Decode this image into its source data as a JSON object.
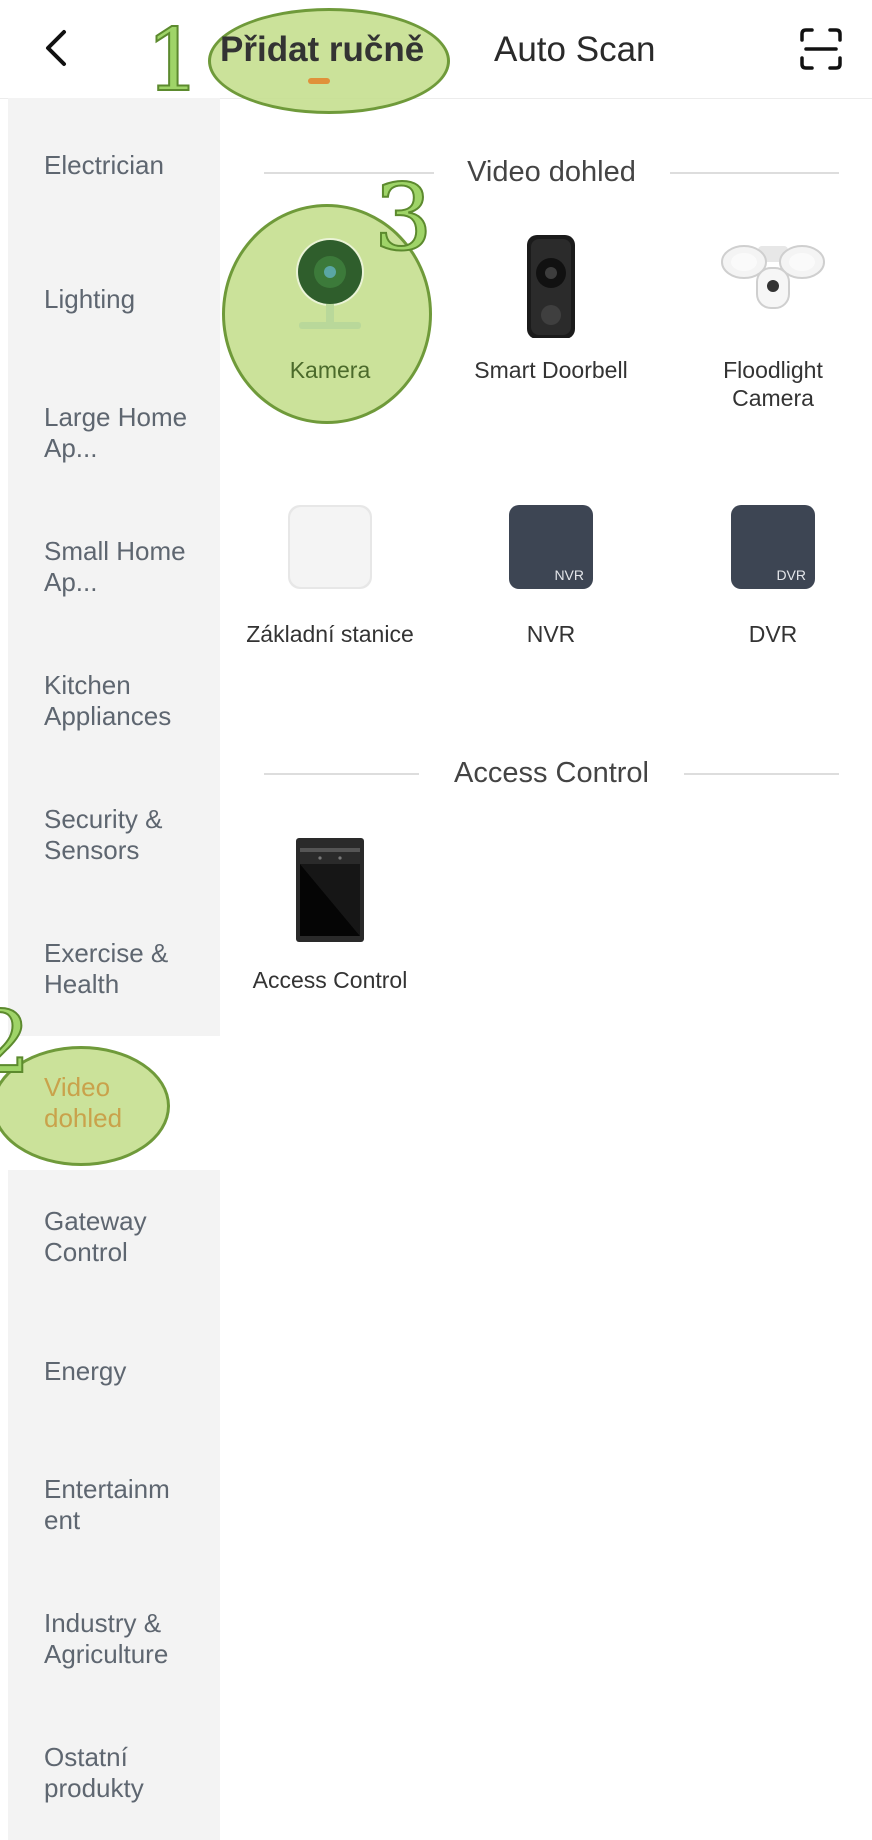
{
  "header": {
    "back_icon": "chevron-left-icon",
    "tabs": [
      {
        "label": "Přidat ručně",
        "active": true
      },
      {
        "label": "Auto Scan",
        "active": false
      }
    ],
    "scan_icon": "qr-scan-icon",
    "accent_color": "#e0913a"
  },
  "annotations": {
    "step1": "1",
    "step2": "2",
    "step3": "3",
    "color": "#c4de8c"
  },
  "sidebar": {
    "items": [
      {
        "label": "Electrician"
      },
      {
        "label": "Lighting"
      },
      {
        "label": "Large Home Ap..."
      },
      {
        "label": "Small Home Ap..."
      },
      {
        "label": "Kitchen Appliances"
      },
      {
        "label": "Security & Sensors"
      },
      {
        "label": "Exercise & Health"
      },
      {
        "label": "Video dohled",
        "active": true
      },
      {
        "label": "Gateway Control"
      },
      {
        "label": "Energy"
      },
      {
        "label": "Entertainm ent"
      },
      {
        "label": "Industry & Agriculture"
      },
      {
        "label": "Ostatní produkty"
      }
    ]
  },
  "main": {
    "sections": [
      {
        "title": "Video dohled",
        "devices": [
          {
            "label": "Kamera",
            "icon": "camera-icon"
          },
          {
            "label": "Smart Doorbell",
            "icon": "doorbell-icon"
          },
          {
            "label": "Floodlight Camera",
            "icon": "floodlight-camera-icon"
          },
          {
            "label": "Základní stanice",
            "icon": "base-station-icon"
          },
          {
            "label": "NVR",
            "icon": "nvr-icon",
            "badge": "NVR"
          },
          {
            "label": "DVR",
            "icon": "dvr-icon",
            "badge": "DVR"
          }
        ]
      },
      {
        "title": "Access Control",
        "devices": [
          {
            "label": "Access Control",
            "icon": "access-control-icon"
          }
        ]
      }
    ]
  }
}
